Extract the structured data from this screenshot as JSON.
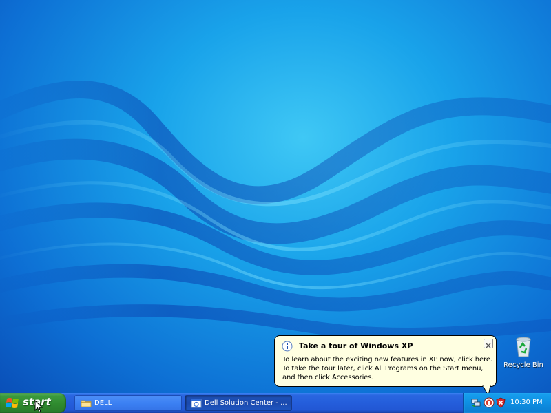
{
  "desktop": {
    "icons": [
      {
        "label": "Recycle Bin",
        "icon": "recycle-bin-icon"
      }
    ]
  },
  "balloon": {
    "icon": "info-icon",
    "title": "Take a tour of Windows XP",
    "lines": [
      "To learn about the exciting new features in XP now, click here.",
      "To take the tour later, click All Programs on the Start menu,",
      "and then click Accessories."
    ],
    "close_icon": "close-icon"
  },
  "taskbar": {
    "start_label": "start",
    "tasks": [
      {
        "label": "DELL",
        "icon": "folder-icon",
        "active": false
      },
      {
        "label": "Dell Solution Center - ...",
        "icon": "browser-window-icon",
        "active": true
      }
    ],
    "tray": {
      "icons": [
        "network-icon",
        "security-center-icon",
        "security-shield-icon"
      ],
      "clock": "10:30 PM"
    }
  },
  "colors": {
    "taskbar_blue": "#245edb",
    "start_green": "#3c9a3c",
    "tray_blue": "#0e8fe2",
    "balloon_bg": "#ffffe1",
    "desktop_blue": "#19a3ea"
  }
}
